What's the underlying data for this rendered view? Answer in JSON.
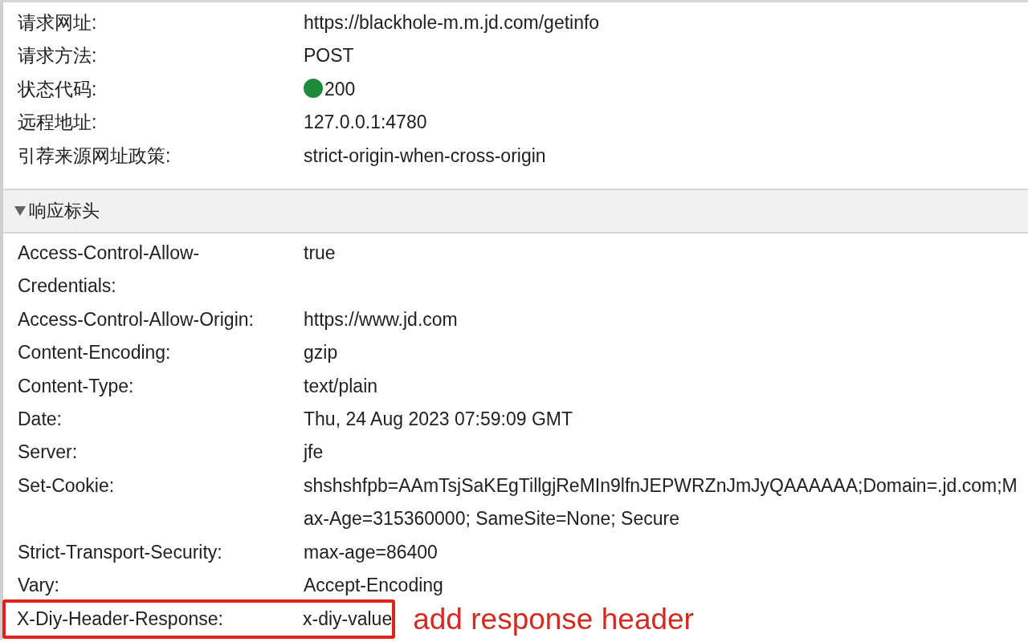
{
  "general": [
    {
      "kind": "text",
      "label": "请求网址:",
      "value": "https://blackhole-m.m.jd.com/getinfo"
    },
    {
      "kind": "text",
      "label": "请求方法:",
      "value": "POST"
    },
    {
      "kind": "status",
      "label": "状态代码:",
      "value": "200",
      "color": "#1e8a3c"
    },
    {
      "kind": "text",
      "label": "远程地址:",
      "value": "127.0.0.1:4780"
    },
    {
      "kind": "text",
      "label": "引荐来源网址政策:",
      "value": "strict-origin-when-cross-origin"
    }
  ],
  "response_headers": {
    "title": "响应标头",
    "expanded": true,
    "rows": [
      {
        "label": "Access-Control-Allow-Credentials:",
        "value": "true",
        "highlighted": false
      },
      {
        "label": "Access-Control-Allow-Origin:",
        "value": "https://www.jd.com",
        "highlighted": false
      },
      {
        "label": "Content-Encoding:",
        "value": "gzip",
        "highlighted": false
      },
      {
        "label": "Content-Type:",
        "value": "text/plain",
        "highlighted": false
      },
      {
        "label": "Date:",
        "value": "Thu, 24 Aug 2023 07:59:09 GMT",
        "highlighted": false
      },
      {
        "label": "Server:",
        "value": "jfe",
        "highlighted": false
      },
      {
        "label": "Set-Cookie:",
        "value": "shshshfpb=AAmTsjSaKEgTillgjReMIn9lfnJEPWRZnJmJyQAAAAAA;Domain=.jd.com;Max-Age=315360000; SameSite=None; Secure",
        "highlighted": false
      },
      {
        "label": "Strict-Transport-Security:",
        "value": "max-age=86400",
        "highlighted": false
      },
      {
        "label": "Vary:",
        "value": "Accept-Encoding",
        "highlighted": false
      },
      {
        "label": "X-Diy-Header-Response:",
        "value": "x-diy-value",
        "highlighted": true
      }
    ]
  },
  "annotation": {
    "text": "add response header"
  }
}
